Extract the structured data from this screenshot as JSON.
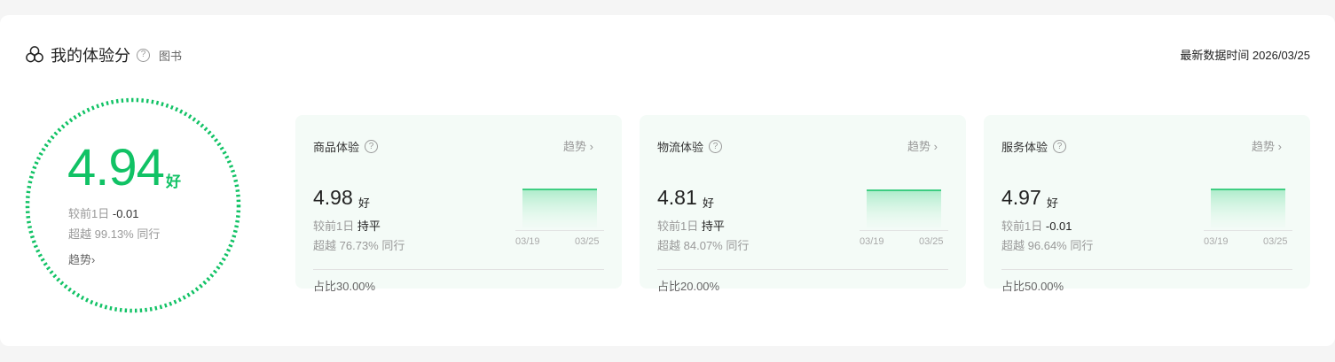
{
  "header": {
    "title": "我的体验分",
    "help": "?",
    "category": "图书",
    "update_label": "最新数据时间 2026/03/25"
  },
  "overall": {
    "score": "4.94",
    "level": "好",
    "prev_day_label": "较前1日",
    "prev_day_value": "-0.01",
    "beat_label": "超越",
    "beat_value": "99.13%",
    "peer_label": "同行",
    "trend_label": "趋势",
    "ring_color": "#11c265"
  },
  "cards": [
    {
      "title": "商品体验",
      "trend_label": "趋势",
      "score": "4.98",
      "level": "好",
      "prev_day_label": "较前1日",
      "prev_day_value": "持平",
      "beat_label": "超越",
      "beat_value": "76.73%",
      "peer_label": "同行",
      "x_start": "03/19",
      "x_end": "03/25",
      "share_label": "占比30.00%"
    },
    {
      "title": "物流体验",
      "trend_label": "趋势",
      "score": "4.81",
      "level": "好",
      "prev_day_label": "较前1日",
      "prev_day_value": "持平",
      "beat_label": "超越",
      "beat_value": "84.07%",
      "peer_label": "同行",
      "x_start": "03/19",
      "x_end": "03/25",
      "share_label": "占比20.00%"
    },
    {
      "title": "服务体验",
      "trend_label": "趋势",
      "score": "4.97",
      "level": "好",
      "prev_day_label": "较前1日",
      "prev_day_value": "-0.01",
      "beat_label": "超越",
      "beat_value": "96.64%",
      "peer_label": "同行",
      "x_start": "03/19",
      "x_end": "03/25",
      "share_label": "占比50.00%"
    }
  ],
  "colors": {
    "accent": "#11c265",
    "card_bg": "#f4fbf7"
  }
}
